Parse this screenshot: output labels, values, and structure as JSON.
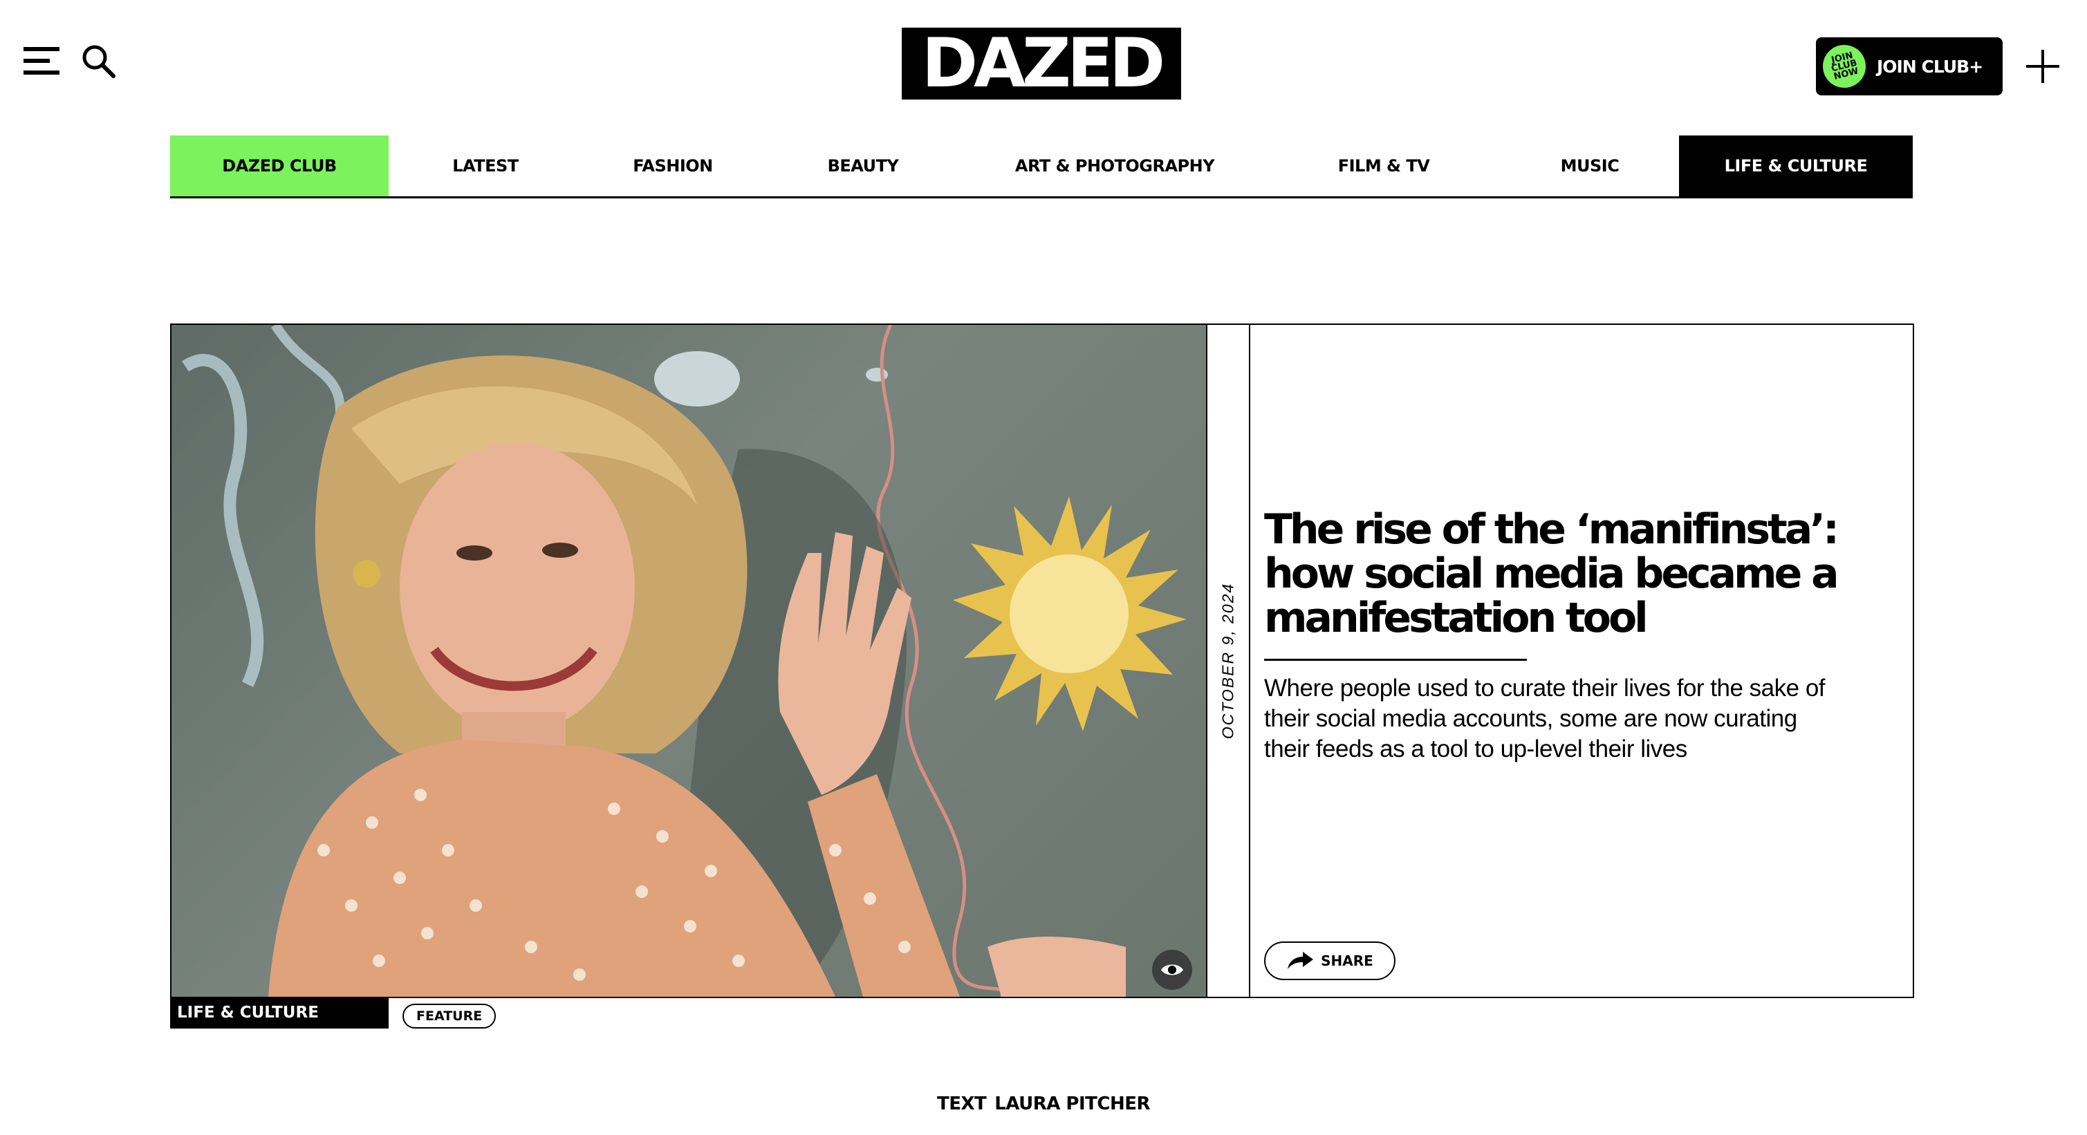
{
  "header": {
    "logo": "DAZED",
    "join_badge": "JOIN CLUB NOW",
    "join_label": "JOIN CLUB+"
  },
  "nav": {
    "items": [
      {
        "label": "DAZED CLUB"
      },
      {
        "label": "LATEST"
      },
      {
        "label": "FASHION"
      },
      {
        "label": "BEAUTY"
      },
      {
        "label": "ART & PHOTOGRAPHY"
      },
      {
        "label": "FILM & TV"
      },
      {
        "label": "MUSIC"
      },
      {
        "label": "LIFE & CULTURE"
      }
    ],
    "active": "LIFE & CULTURE"
  },
  "article": {
    "date": "OCTOBER 9, 2024",
    "headline": "The rise of the ‘manifinsta’: how social media became a manifestation tool",
    "standfirst": "Where people used to curate their lives for the sake of their social media accounts, some are now curating their feeds as a tool to up-level their lives",
    "share_label": "SHARE",
    "category_tag": "LIFE & CULTURE",
    "type_tag": "FEATURE",
    "byline_prefix": "TEXT",
    "byline_author": "LAURA PITCHER"
  },
  "colors": {
    "club_green": "#7cf25c",
    "black": "#000000",
    "white": "#ffffff"
  }
}
